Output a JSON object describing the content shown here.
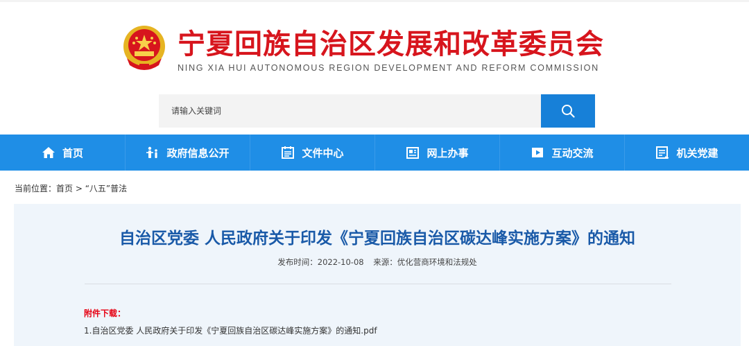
{
  "header": {
    "title": "宁夏回族自治区发展和改革委员会",
    "subtitle": "NING XIA HUI AUTONOMOUS REGION DEVELOPMENT AND REFORM COMMISSION"
  },
  "search": {
    "placeholder": "请输入关键词"
  },
  "nav": {
    "items": [
      {
        "label": "首页",
        "icon": "home-icon"
      },
      {
        "label": "政府信息公开",
        "icon": "people-icon"
      },
      {
        "label": "文件中心",
        "icon": "document-icon"
      },
      {
        "label": "网上办事",
        "icon": "news-icon"
      },
      {
        "label": "互动交流",
        "icon": "play-icon"
      },
      {
        "label": "机关党建",
        "icon": "list-icon"
      }
    ]
  },
  "breadcrumb": {
    "prefix": "当前位置：",
    "home": "首页",
    "sep": " > ",
    "current": "“八五”普法"
  },
  "article": {
    "title": "自治区党委 人民政府关于印发《宁夏回族自治区碳达峰实施方案》的通知",
    "publish_time": "发布时间：2022-10-08",
    "source": "来源：优化营商环境和法规处",
    "attachment_label": "附件下载：",
    "attachment_link": "1.自治区党委 人民政府关于印发《宁夏回族自治区碳达峰实施方案》的通知.pdf"
  },
  "colors": {
    "brand_red": "#d7151d",
    "nav_blue": "#1f8ee6",
    "title_blue": "#1a5aa8"
  }
}
